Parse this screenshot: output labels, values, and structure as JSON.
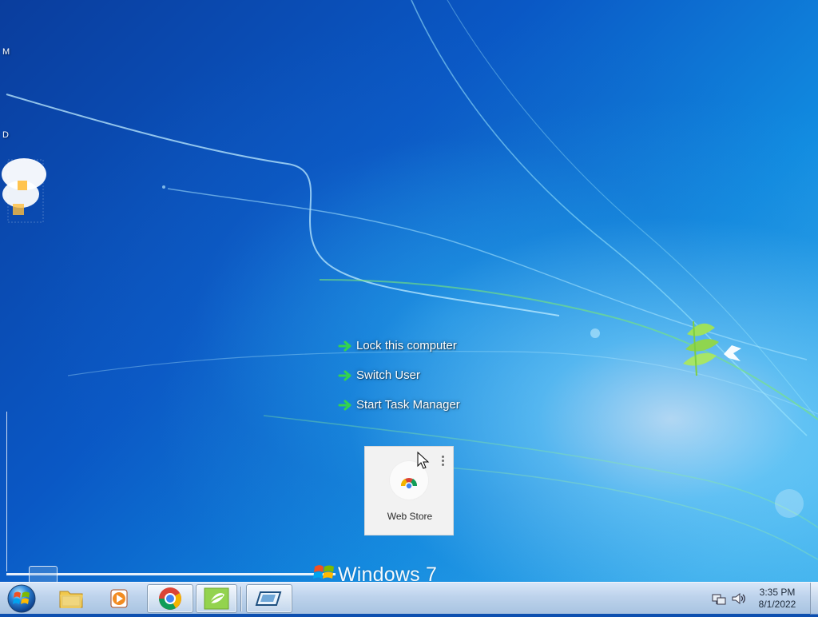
{
  "desktop": {
    "edge_labels": [
      "M",
      "D"
    ],
    "menu": {
      "items": [
        {
          "label": "Lock this computer",
          "icon": "green-arrow-icon"
        },
        {
          "label": "Switch User",
          "icon": "green-arrow-icon"
        },
        {
          "label": "Start Task Manager",
          "icon": "green-arrow-icon"
        }
      ]
    },
    "webstore_card": {
      "label": "Web Store",
      "icon": "chrome-web-store-icon",
      "menu_icon": "more-vert-icon"
    },
    "wallpaper_wordmark": "Windows 7"
  },
  "taskbar": {
    "start_icon": "windows-start-orb-icon",
    "apps": [
      {
        "name": "file-explorer",
        "icon": "folder-icon"
      },
      {
        "name": "media-player",
        "icon": "media-player-icon"
      },
      {
        "name": "google-chrome",
        "icon": "chrome-icon"
      },
      {
        "name": "green-app",
        "icon": "green-leaf-icon"
      },
      {
        "name": "secondary-window",
        "icon": "window-icon"
      }
    ],
    "tray": {
      "icons": [
        "network-icon",
        "speaker-icon"
      ],
      "time": "3:35 PM",
      "date": "8/1/2022"
    }
  },
  "colors": {
    "desktop_dark": "#0a3d9d",
    "desktop_light": "#4ab8ef",
    "taskbar": "#c4d8ee",
    "menu_text": "#ffffff",
    "card": "#f2f2f2"
  }
}
